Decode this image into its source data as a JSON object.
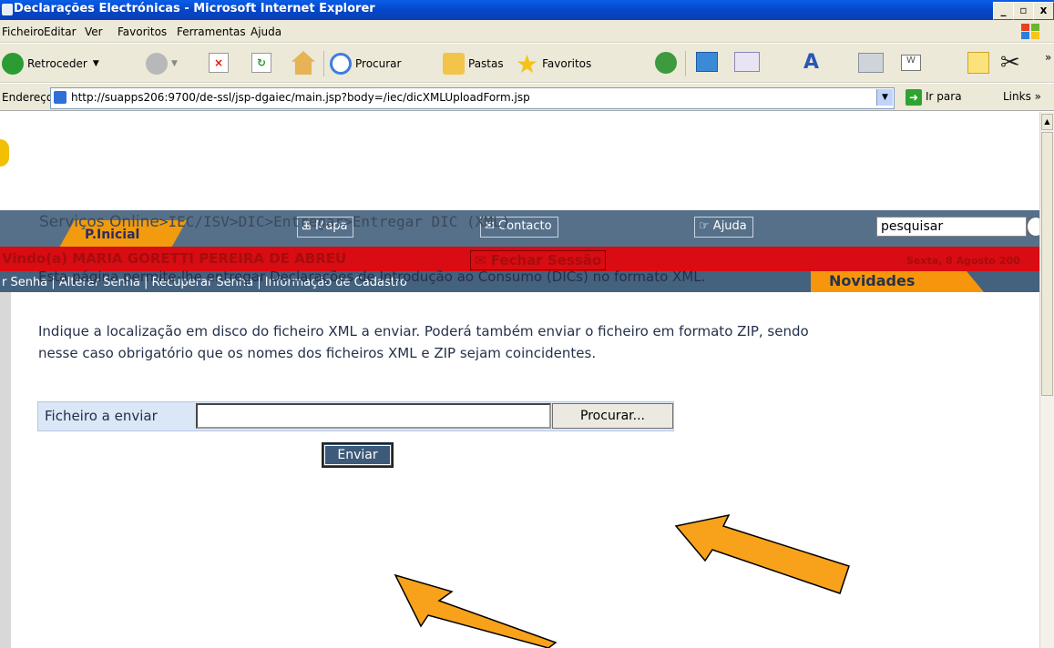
{
  "window": {
    "title": "Declarações Electrónicas - Microsoft Internet Explorer",
    "minimize": "_",
    "maximize": "▫",
    "close": "x"
  },
  "menu": [
    "Ficheiro",
    "Editar",
    "Ver",
    "Favoritos",
    "Ferramentas",
    "Ajuda"
  ],
  "toolbar": {
    "back": "Retroceder",
    "search": "Procurar",
    "folders": "Pastas",
    "favorites": "Favoritos"
  },
  "address": {
    "label": "Endereço",
    "url": "http://suapps206:9700/de-ssl/jsp-dgaiec/main.jsp?body=/iec/dicXMLUploadForm.jsp",
    "go": "Ir para",
    "links": "Links"
  },
  "nav": {
    "home": "P.Inicial",
    "map": "Mapa",
    "contact": "Contacto",
    "help": "Ajuda",
    "search_placeholder": "pesquisar"
  },
  "session": {
    "welcome": "Vindo(a) MARIA GORETTI PEREIRA DE ABREU",
    "logout": "Fechar Sessão",
    "date": "Sexta, 8 Agosto 200"
  },
  "sublinks": "r Senha  |  Alterar Senha  |  Recuperar Senha  |  Informação de Cadastro",
  "novidades": "Novidades",
  "breadcrumb": {
    "root": "Serviços Online",
    "path": ">IEC/ISV>DIC>Entregar>Entregar DIC (XML)"
  },
  "content": {
    "para1": "Esta página permite-lhe entregar Declarações de Introdução ao Consumo (DICs) no formato XML.",
    "para2_line1": "Indique a localização em disco do ficheiro XML a enviar. Poderá também enviar o ficheiro em formato ZIP, sendo",
    "para2_line2": "nesse caso obrigatório que os nomes dos ficheiros XML e ZIP sejam coincidentes."
  },
  "form": {
    "file_label": "Ficheiro a enviar",
    "file_value": "",
    "browse": "Procurar...",
    "send": "Enviar"
  },
  "colors": {
    "accent_orange": "#f29b0e",
    "nav_blue": "#57708a",
    "welcome_red": "#d80c12",
    "arrow": "#f7a21a"
  }
}
